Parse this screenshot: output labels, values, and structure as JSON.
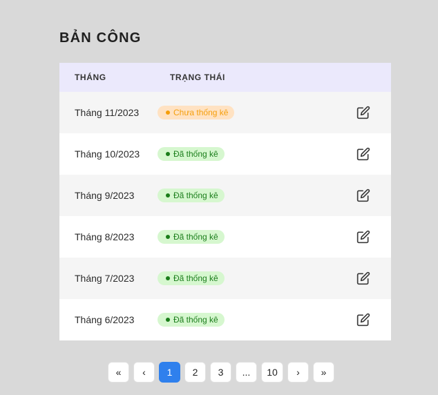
{
  "page": {
    "title": "BẢN CÔNG"
  },
  "table": {
    "headers": {
      "month": "THÁNG",
      "status": "TRẠNG THÁI"
    },
    "rows": [
      {
        "month": "Tháng 11/2023",
        "status": "Chưa thống kê",
        "status_type": "pending"
      },
      {
        "month": "Tháng 10/2023",
        "status": "Đã thống kê",
        "status_type": "done"
      },
      {
        "month": "Tháng 9/2023",
        "status": "Đã thống kê",
        "status_type": "done"
      },
      {
        "month": "Tháng 8/2023",
        "status": "Đã thống kê",
        "status_type": "done"
      },
      {
        "month": "Tháng 7/2023",
        "status": "Đã thống kê",
        "status_type": "done"
      },
      {
        "month": "Tháng 6/2023",
        "status": "Đã thống kê",
        "status_type": "done"
      }
    ],
    "action_icon": "edit-icon"
  },
  "pagination": {
    "first_label": "«",
    "prev_label": "‹",
    "pages": [
      "1",
      "2",
      "3",
      "...",
      "10"
    ],
    "current_page": "1",
    "next_label": "›",
    "last_label": "»"
  },
  "colors": {
    "header_bg": "#ebe9fc",
    "pending_bg": "#ffe2c2",
    "pending_text": "#f59e0b",
    "done_bg": "#d6f7cf",
    "done_text": "#1a7d1a",
    "active_page": "#2f80ed"
  }
}
